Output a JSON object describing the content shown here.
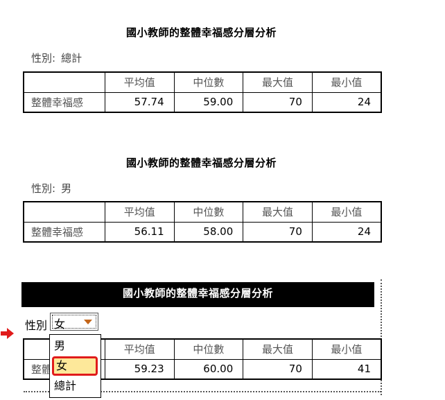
{
  "report": {
    "title": "國小教師的整體幸福感分層分析",
    "layer_label": "性別:",
    "columns": [
      "平均值",
      "中位數",
      "最大值",
      "最小值"
    ],
    "row_label": "整體幸福感",
    "sections": [
      {
        "layer_value": "總計",
        "values": [
          "57.74",
          "59.00",
          "70",
          "24"
        ]
      },
      {
        "layer_value": "男",
        "values": [
          "56.11",
          "58.00",
          "70",
          "24"
        ]
      },
      {
        "layer_value": "女",
        "values": [
          "59.23",
          "60.00",
          "70",
          "41"
        ]
      }
    ]
  },
  "active_layer": {
    "label": "性別",
    "selected": "女",
    "options": [
      "男",
      "女",
      "總計"
    ],
    "highlighted_option": "女"
  },
  "colors": {
    "banner_bg": "#000000",
    "highlight_fill": "#fde89a",
    "highlight_border": "#e01b1b",
    "pointer_arrow": "#e01b1b",
    "combo_arrow": "#c4661a"
  }
}
